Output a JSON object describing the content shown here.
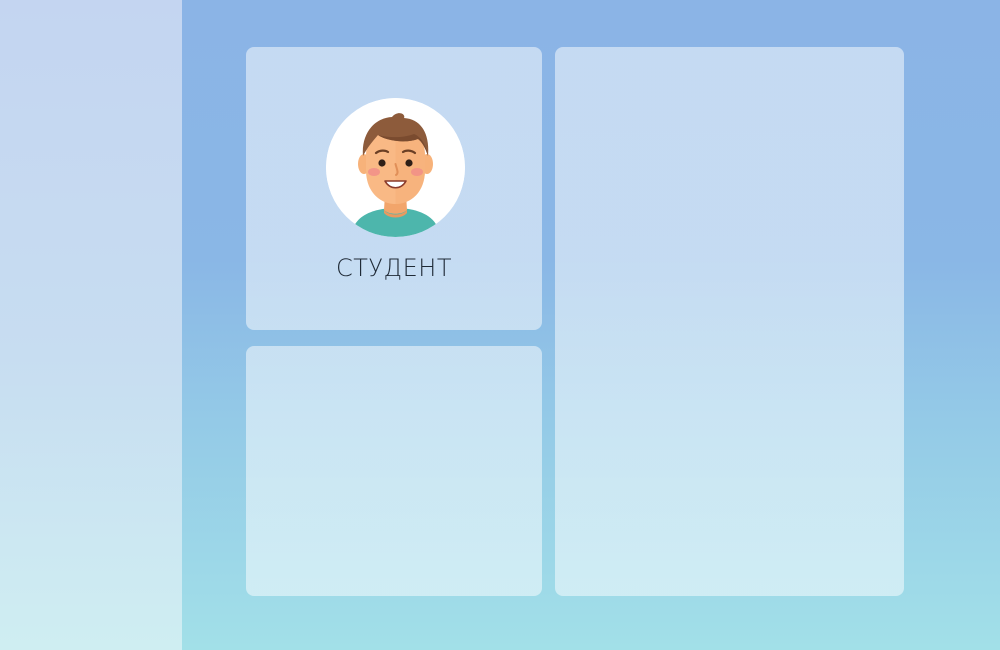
{
  "profile": {
    "role_label": "СТУДЕНТ",
    "avatar_icon": "student-avatar-icon"
  },
  "colors": {
    "background_top": "#8bb4e6",
    "background_bottom": "#a2e0e8",
    "sidebar_top": "#c4d5f1",
    "sidebar_bottom": "#cfeef2",
    "text": "#1f2a36"
  }
}
